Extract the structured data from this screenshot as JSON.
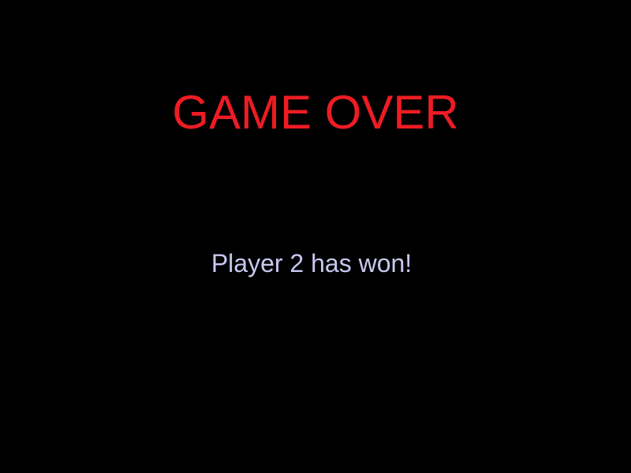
{
  "screen": {
    "title": "GAME OVER",
    "message": "Player 2 has won!"
  },
  "colors": {
    "background": "#000000",
    "title": "#ed1c24",
    "message": "#c8c8f0"
  }
}
